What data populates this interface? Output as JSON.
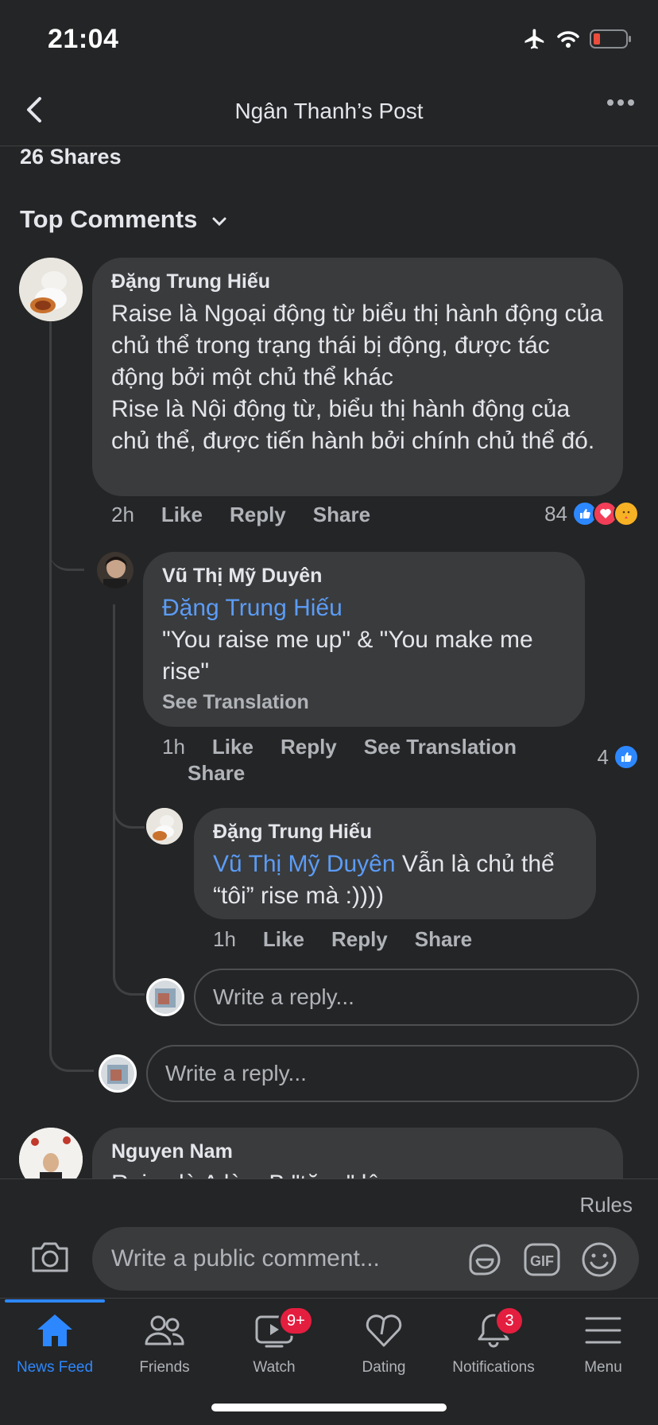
{
  "status": {
    "time": "21:04"
  },
  "header": {
    "title": "Ngân Thanh’s Post"
  },
  "shares": "26 Shares",
  "section_title": "Top Comments",
  "comments": [
    {
      "author": "Đặng Trung Hiếu",
      "text": "Raise là Ngoại động từ biểu thị hành động của chủ thể trong trạng thái bị động, được tác động bởi một chủ thể khác\nRise là Nội động từ, biểu thị hành động của chủ thể, được tiến hành bởi chính chủ thể đó.",
      "time": "2h",
      "like": "Like",
      "reply": "Reply",
      "share": "Share",
      "reaction_count": "84"
    },
    {
      "author": "Vũ Thị Mỹ Duyên",
      "mention": "Đặng Trung Hiếu",
      "text": "\"You raise me up\" & \"You make me rise\"",
      "see_translation": "See Translation",
      "time": "1h",
      "like": "Like",
      "reply": "Reply",
      "see_translation_action": "See Translation",
      "share": "Share",
      "reaction_count": "4"
    },
    {
      "author": "Đặng Trung Hiếu",
      "mention": "Vũ Thị Mỹ Duyên",
      "text": " Vẫn là chủ thể “tôi” rise mà :))))",
      "time": "1h",
      "like": "Like",
      "reply": "Reply",
      "share": "Share"
    },
    {
      "author": "Nguyen Nam",
      "text": "Raise là A làm B \"tăng\" lên"
    }
  ],
  "reply_placeholder": "Write a reply...",
  "rules": "Rules",
  "public_comment_placeholder": "Write a public comment...",
  "tabs": [
    {
      "label": "News Feed",
      "icon": "home-icon",
      "active": true
    },
    {
      "label": "Friends",
      "icon": "friends-icon"
    },
    {
      "label": "Watch",
      "icon": "watch-icon",
      "badge": "9+"
    },
    {
      "label": "Dating",
      "icon": "dating-icon"
    },
    {
      "label": "Notifications",
      "icon": "bell-icon",
      "badge": "3"
    },
    {
      "label": "Menu",
      "icon": "menu-icon"
    }
  ],
  "colors": {
    "background": "#242526",
    "bubble": "#3a3b3c",
    "accent": "#2d88ff",
    "mention": "#5b9cf7",
    "badge": "#e41e3f"
  }
}
